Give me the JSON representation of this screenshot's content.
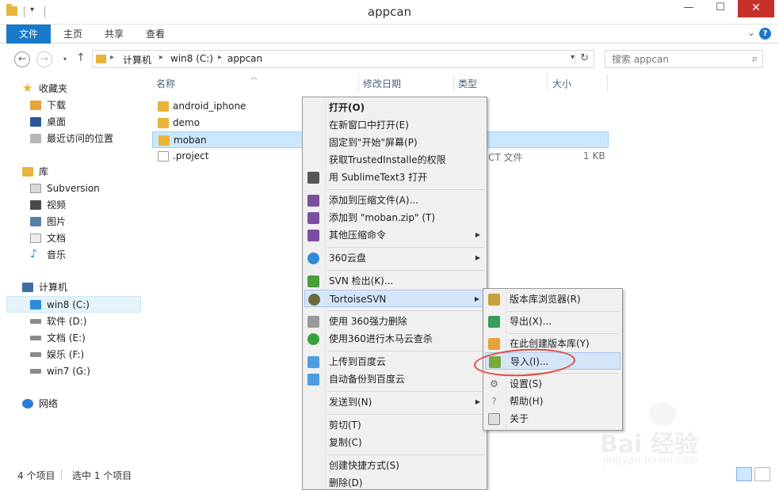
{
  "window": {
    "title": "appcan",
    "minimize": "—",
    "maximize": "☐",
    "close": "✕"
  },
  "ribbon": {
    "tabs": [
      "文件",
      "主页",
      "共享",
      "查看"
    ]
  },
  "address": {
    "crumbs": [
      "计算机",
      "win8 (C:)",
      "appcan"
    ]
  },
  "search": {
    "placeholder": "搜索 appcan"
  },
  "sidebar": {
    "items": [
      {
        "label": "收藏夹",
        "icon": "star-icon",
        "color": "#f2b01e"
      },
      {
        "label": "下载",
        "icon": "download-folder-icon",
        "color": "#e8a23a"
      },
      {
        "label": "桌面",
        "icon": "desktop-icon",
        "color": "#2b579a"
      },
      {
        "label": "最近访问的位置",
        "icon": "recent-places-icon",
        "color": "#8a8a8a"
      },
      {
        "label": "库",
        "icon": "library-icon",
        "color": "#e8b43a"
      },
      {
        "label": "Subversion",
        "icon": "library-doc-icon",
        "color": "#d0d0d0"
      },
      {
        "label": "视频",
        "icon": "video-icon",
        "color": "#4a4a4a"
      },
      {
        "label": "图片",
        "icon": "pictures-icon",
        "color": "#5a7fa8"
      },
      {
        "label": "文档",
        "icon": "documents-icon",
        "color": "#c8c8c8"
      },
      {
        "label": "音乐",
        "icon": "music-icon",
        "color": "#2e7bd6"
      },
      {
        "label": "计算机",
        "icon": "computer-icon",
        "color": "#3a6ea5"
      },
      {
        "label": "win8 (C:)",
        "icon": "windows-drive-icon",
        "color": "#2e8bd8"
      },
      {
        "label": "软件 (D:)",
        "icon": "drive-icon",
        "color": "#8a8a8a"
      },
      {
        "label": "文档 (E:)",
        "icon": "drive-icon",
        "color": "#8a8a8a"
      },
      {
        "label": "娱乐 (F:)",
        "icon": "drive-icon",
        "color": "#8a8a8a"
      },
      {
        "label": "win7 (G:)",
        "icon": "drive-icon",
        "color": "#8a8a8a"
      },
      {
        "label": "网络",
        "icon": "network-icon",
        "color": "#2e7bd6"
      }
    ]
  },
  "columns": {
    "name": "名称",
    "modified": "修改日期",
    "type": "类型",
    "size": "大小"
  },
  "files": [
    {
      "name": "android_iphone",
      "icon": "folder-icon"
    },
    {
      "name": "demo",
      "icon": "folder-icon"
    },
    {
      "name": "moban",
      "icon": "folder-icon"
    },
    {
      "name": ".project",
      "icon": "file-icon"
    }
  ],
  "file_project_type": "CT 文件",
  "file_project_size": "1 KB",
  "status": {
    "count": "4 个项目",
    "selected": "选中 1 个项目"
  },
  "context_menu": {
    "items": [
      {
        "label": "打开(O)",
        "bold": true
      },
      {
        "label": "在新窗口中打开(E)"
      },
      {
        "label": "固定到\"开始\"屏幕(P)"
      },
      {
        "label": "获取TrustedInstalle的权限"
      },
      {
        "label": "用 SublimeText3 打开",
        "icon": "sublime-icon"
      },
      {
        "label": "添加到压缩文件(A)...",
        "icon": "winrar-icon"
      },
      {
        "label": "添加到 \"moban.zip\" (T)",
        "icon": "winrar-icon"
      },
      {
        "label": "其他压缩命令",
        "icon": "winrar-icon",
        "arrow": true
      },
      {
        "label": "360云盘",
        "icon": "cloud-360-icon",
        "arrow": true
      },
      {
        "label": "SVN 检出(K)...",
        "icon": "svn-checkout-icon"
      },
      {
        "label": "TortoiseSVN",
        "icon": "tortoise-icon",
        "arrow": true
      },
      {
        "label": "使用 360强力删除",
        "icon": "shredder-icon"
      },
      {
        "label": "使用360进行木马云查杀",
        "icon": "scan-360-icon"
      },
      {
        "label": "上传到百度云",
        "icon": "baidu-cloud-icon"
      },
      {
        "label": "自动备份到百度云",
        "icon": "baidu-cloud-icon"
      },
      {
        "label": "发送到(N)",
        "arrow": true
      },
      {
        "label": "剪切(T)"
      },
      {
        "label": "复制(C)"
      },
      {
        "label": "创建快捷方式(S)"
      },
      {
        "label": "删除(D)"
      }
    ]
  },
  "submenu": {
    "items": [
      {
        "label": "版本库浏览器(R)",
        "icon": "repo-browser-icon"
      },
      {
        "label": "导出(X)...",
        "icon": "export-icon"
      },
      {
        "label": "在此创建版本库(Y)",
        "icon": "create-repo-icon"
      },
      {
        "label": "导入(I)...",
        "icon": "import-icon"
      },
      {
        "label": "设置(S)",
        "icon": "settings-icon"
      },
      {
        "label": "帮助(H)",
        "icon": "help-icon"
      },
      {
        "label": "关于",
        "icon": "about-icon"
      }
    ]
  },
  "watermark": {
    "brand": "Bai 经验",
    "url": "jingyan.baidu.com"
  }
}
